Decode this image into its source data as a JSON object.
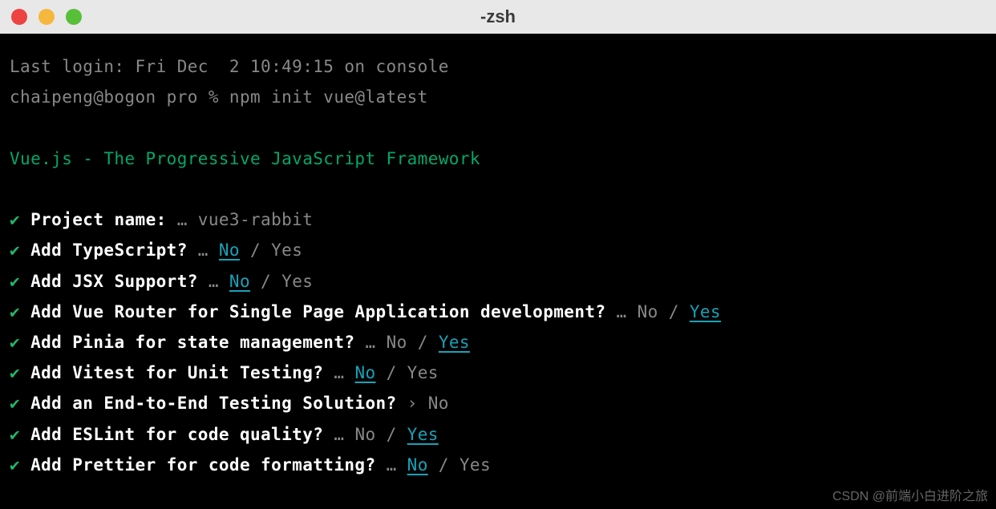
{
  "window": {
    "title": "-zsh"
  },
  "terminal": {
    "last_login": "Last login: Fri Dec  2 10:49:15 on console",
    "prompt_user": "chaipeng@bogon pro % ",
    "command": "npm init vue@latest",
    "banner": "Vue.js - The Progressive JavaScript Framework",
    "check": "✔",
    "ellipsis": "…",
    "caret": "›",
    "slash": " / ",
    "prompts": [
      {
        "question": "Project name:",
        "answer_plain": "vue3-rabbit",
        "type": "text"
      },
      {
        "question": "Add TypeScript?",
        "no": "No",
        "yes": "Yes",
        "selected": "no",
        "type": "choice"
      },
      {
        "question": "Add JSX Support?",
        "no": "No",
        "yes": "Yes",
        "selected": "no",
        "type": "choice"
      },
      {
        "question": "Add Vue Router for Single Page Application development?",
        "no": "No",
        "yes": "Yes",
        "selected": "yes",
        "type": "choice"
      },
      {
        "question": "Add Pinia for state management?",
        "no": "No",
        "yes": "Yes",
        "selected": "yes",
        "type": "choice"
      },
      {
        "question": "Add Vitest for Unit Testing?",
        "no": "No",
        "yes": "Yes",
        "selected": "no",
        "type": "choice"
      },
      {
        "question": "Add an End-to-End Testing Solution?",
        "answer_plain": "No",
        "type": "caret"
      },
      {
        "question": "Add ESLint for code quality?",
        "no": "No",
        "yes": "Yes",
        "selected": "yes",
        "type": "choice"
      },
      {
        "question": "Add Prettier for code formatting?",
        "no": "No",
        "yes": "Yes",
        "selected": "no",
        "type": "choice"
      }
    ]
  },
  "watermark": "CSDN @前端小白进阶之旅"
}
